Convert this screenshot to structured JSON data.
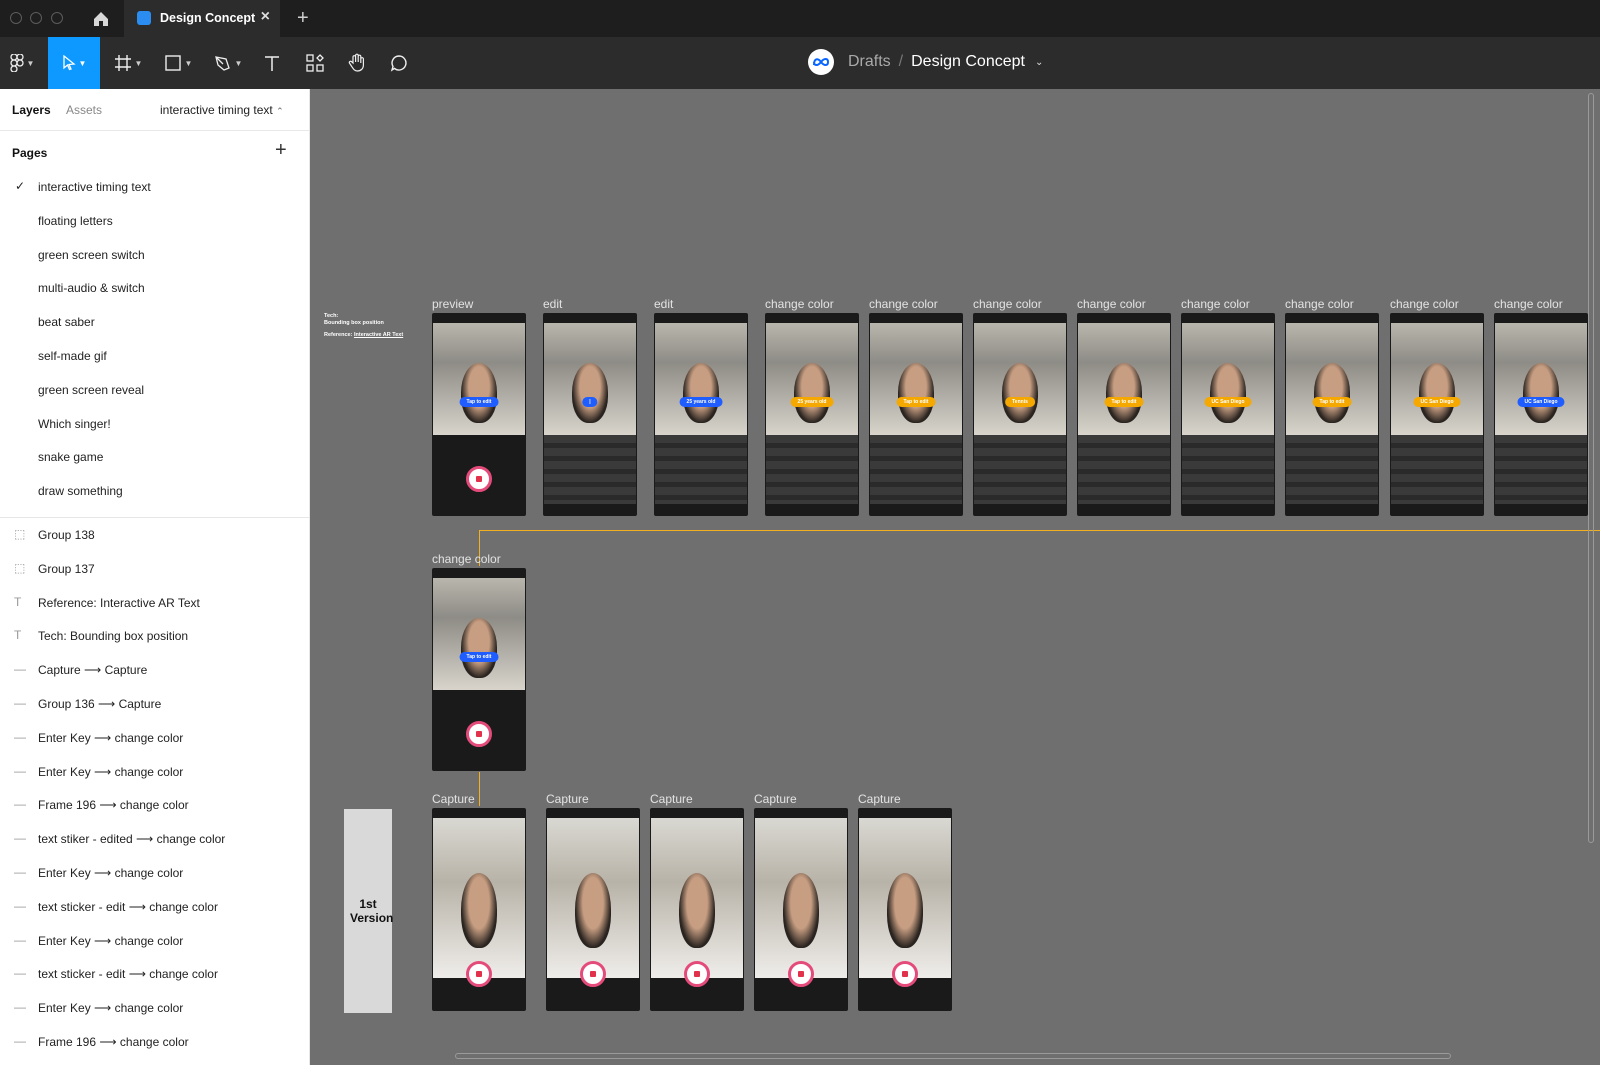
{
  "tab": {
    "title": "Design Concept"
  },
  "header": {
    "drafts": "Drafts",
    "separator": "/",
    "file": "Design Concept"
  },
  "sidebar": {
    "tab_layers": "Layers",
    "tab_assets": "Assets",
    "current_page": "interactive timing text",
    "pages_title": "Pages",
    "pages": [
      "interactive timing text",
      "floating letters",
      "green screen switch",
      "multi-audio & switch",
      "beat saber",
      "self-made gif",
      "green screen reveal",
      "Which singer!",
      "snake game",
      "draw something"
    ],
    "layers": [
      {
        "name": "Group 138",
        "icon": "group-icon"
      },
      {
        "name": "Group 137",
        "icon": "group-icon"
      },
      {
        "name": "Reference: Interactive AR Text",
        "icon": "text-icon"
      },
      {
        "name": "Tech: Bounding box position",
        "icon": "text-icon"
      },
      {
        "name": "Capture ⟶ Capture",
        "icon": "connector-icon"
      },
      {
        "name": "Group 136 ⟶ Capture",
        "icon": "connector-icon"
      },
      {
        "name": "Enter Key ⟶ change color",
        "icon": "connector-icon"
      },
      {
        "name": "Enter Key ⟶ change color",
        "icon": "connector-icon"
      },
      {
        "name": "Frame 196 ⟶ change color",
        "icon": "connector-icon"
      },
      {
        "name": "text stiker - edited ⟶ change color",
        "icon": "connector-icon"
      },
      {
        "name": "Enter Key ⟶ change color",
        "icon": "connector-icon"
      },
      {
        "name": "text sticker - edit ⟶ change color",
        "icon": "connector-icon"
      },
      {
        "name": "Enter Key ⟶ change color",
        "icon": "connector-icon"
      },
      {
        "name": "text sticker - edit ⟶ change color",
        "icon": "connector-icon"
      },
      {
        "name": "Enter Key ⟶ change color",
        "icon": "connector-icon"
      },
      {
        "name": "Frame 196 ⟶ change color",
        "icon": "connector-icon"
      }
    ]
  },
  "canvas": {
    "note_tech": "Tech:",
    "note_bbox": "Bounding box position",
    "note_ref": "Reference:",
    "note_ref_link": "Interactive AR Text",
    "version_label": "1st Version",
    "row1": [
      {
        "label": "preview",
        "pill": "Tap to edit",
        "color": "#1f5dff",
        "keyboard": false
      },
      {
        "label": "edit",
        "pill": "|",
        "color": "#1f5dff",
        "keyboard": true
      },
      {
        "label": "edit",
        "pill": "25 years old",
        "color": "#1f5dff",
        "keyboard": true
      },
      {
        "label": "change color",
        "pill": "25 years old",
        "color": "#f5a800",
        "keyboard": true
      },
      {
        "label": "change color",
        "pill": "Tap to edit",
        "color": "#f5a800",
        "keyboard": true
      },
      {
        "label": "change color",
        "pill": "Tennis",
        "color": "#f5a800",
        "keyboard": true
      },
      {
        "label": "change color",
        "pill": "Tap to edit",
        "color": "#f5a800",
        "keyboard": true
      },
      {
        "label": "change color",
        "pill": "UC San Diego",
        "color": "#f5a800",
        "keyboard": true
      },
      {
        "label": "change color",
        "pill": "Tap to edit",
        "color": "#f5a800",
        "keyboard": true
      },
      {
        "label": "change color",
        "pill": "UC San Diego",
        "color": "#f5a800",
        "keyboard": true
      },
      {
        "label": "change color",
        "pill": "UC San Diego",
        "color": "#1f5dff",
        "keyboard": true
      }
    ],
    "row2": [
      {
        "label": "change color",
        "pill": "Tap to edit",
        "color": "#1f5dff",
        "keyboard": false
      }
    ],
    "captures": [
      {
        "label": "Capture"
      },
      {
        "label": "Capture"
      },
      {
        "label": "Capture"
      },
      {
        "label": "Capture"
      },
      {
        "label": "Capture"
      }
    ]
  }
}
